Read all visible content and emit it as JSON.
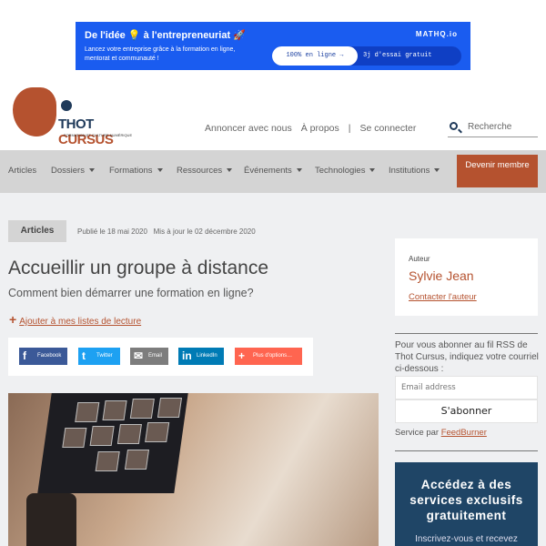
{
  "ad": {
    "title": "De l'idée 💡 à l'entrepreneuriat 🚀",
    "text": "Lancez votre entreprise grâce à la formation en ligne, mentorat et communauté !",
    "brand": "MATHQ.io",
    "cta_primary": "100% en ligne →",
    "cta_secondary": "3j d'essai gratuit"
  },
  "logo": {
    "name_a": "THOT ",
    "name_b": "CURSUS",
    "tagline": "FORMATION ET CULTURE NUMÉRIQUE"
  },
  "toplinks": [
    "Annoncer avec nous",
    "À propos",
    "|",
    "Se connecter"
  ],
  "search": {
    "placeholder": "Recherche"
  },
  "nav": {
    "items": [
      "Articles",
      "Dossiers",
      "Formations",
      "Ressources",
      "Événements",
      "Technologies",
      "Institutions"
    ],
    "member": "Devenir membre"
  },
  "article": {
    "category": "Articles",
    "published": "Publié le 18 mai 2020",
    "updated": "Mis à jour le 02 décembre 2020",
    "title": "Accueillir un groupe à distance",
    "subtitle": "Comment bien démarrer une formation en ligne?",
    "add_list": "Ajouter à mes listes de lecture"
  },
  "share": [
    {
      "label": "Facebook",
      "icon": "f",
      "color": "#3b5998"
    },
    {
      "label": "Twitter",
      "icon": "t",
      "color": "#1da1f2"
    },
    {
      "label": "Email",
      "icon": "✉",
      "color": "#7d7d7d"
    },
    {
      "label": "LinkedIn",
      "icon": "in",
      "color": "#007bb5"
    },
    {
      "label": "Plus d'options…",
      "icon": "+",
      "color": "#ff6550"
    }
  ],
  "author": {
    "label": "Auteur",
    "name": "Sylvie Jean",
    "contact": "Contacter l'auteur"
  },
  "rss": {
    "text": "Pour vous abonner au fil RSS de Thot Cursus, indiquez votre courriel ci-dessous :",
    "email_placeholder": "Email address",
    "button": "S'abonner",
    "service": "Service par ",
    "service_link": "FeedBurner"
  },
  "promo": {
    "title": "Accédez à des services exclusifs gratuitement",
    "text": "Inscrivez-vous et recevez"
  },
  "colors": {
    "accent": "#b5522f",
    "navy": "#1f4566",
    "ad_blue": "#1a5cf0"
  }
}
